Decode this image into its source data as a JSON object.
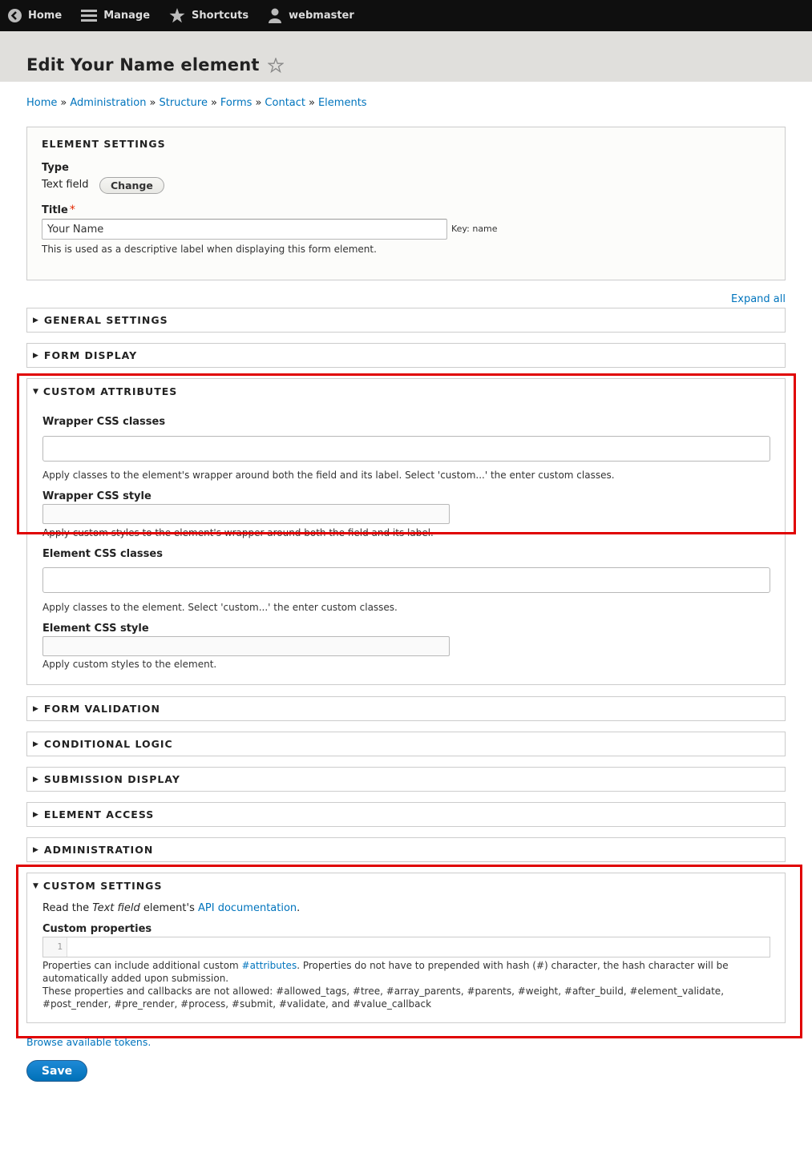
{
  "toolbar": {
    "home": "Home",
    "manage": "Manage",
    "shortcuts": "Shortcuts",
    "user": "webmaster"
  },
  "page": {
    "title": "Edit Your Name element"
  },
  "breadcrumb": [
    "Home",
    "Administration",
    "Structure",
    "Forms",
    "Contact",
    "Elements"
  ],
  "breadcrumb_separator": "»",
  "element_settings": {
    "legend": "ELEMENT SETTINGS",
    "type_label": "Type",
    "type_value": "Text field",
    "change_button": "Change",
    "title_label": "Title",
    "required_mark": "*",
    "title_value": "Your Name",
    "key_text": "Key: name",
    "title_description": "This is used as a descriptive label when displaying this form element."
  },
  "expand_all": "Expand all",
  "sections": {
    "general": "GENERAL SETTINGS",
    "form_display": "FORM DISPLAY",
    "custom_attributes": "CUSTOM ATTRIBUTES",
    "form_validation": "FORM VALIDATION",
    "conditional_logic": "CONDITIONAL LOGIC",
    "submission_display": "SUBMISSION DISPLAY",
    "element_access": "ELEMENT ACCESS",
    "administration": "ADMINISTRATION",
    "custom_settings": "CUSTOM SETTINGS"
  },
  "custom_attributes": {
    "wrapper_classes_label": "Wrapper CSS classes",
    "wrapper_classes_desc": "Apply classes to the element's wrapper around both the field and its label. Select 'custom...' the enter custom classes.",
    "wrapper_style_label": "Wrapper CSS style",
    "wrapper_style_desc": "Apply custom styles to the element's wrapper around both the field and its label.",
    "element_classes_label": "Element CSS classes",
    "element_classes_desc": "Apply classes to the element. Select 'custom...' the enter custom classes.",
    "element_style_label": "Element CSS style",
    "element_style_desc": "Apply custom styles to the element."
  },
  "custom_settings": {
    "intro_pre": "Read the ",
    "intro_em": "Text field",
    "intro_mid": " element's ",
    "intro_link": "API documentation",
    "intro_post": ".",
    "properties_label": "Custom properties",
    "line_number": "1",
    "desc1_pre": "Properties can include additional custom ",
    "desc1_link": "#attributes",
    "desc1_post": ". Properties do not have to prepended with hash (#) character, the hash character will be automatically added upon submission.",
    "desc2": "These properties and callbacks are not allowed: #allowed_tags, #tree, #array_parents, #parents, #weight, #after_build, #element_validate, #post_render, #pre_render, #process, #submit, #validate, and #value_callback"
  },
  "browse_tokens": "Browse available tokens.",
  "save_button": "Save",
  "colors": {
    "link": "#0074bd",
    "toolbar_bg": "#0f0f0f",
    "header_bg": "#e0dfdc",
    "highlight_frame": "#e00000",
    "save_button": "#0071b8"
  }
}
